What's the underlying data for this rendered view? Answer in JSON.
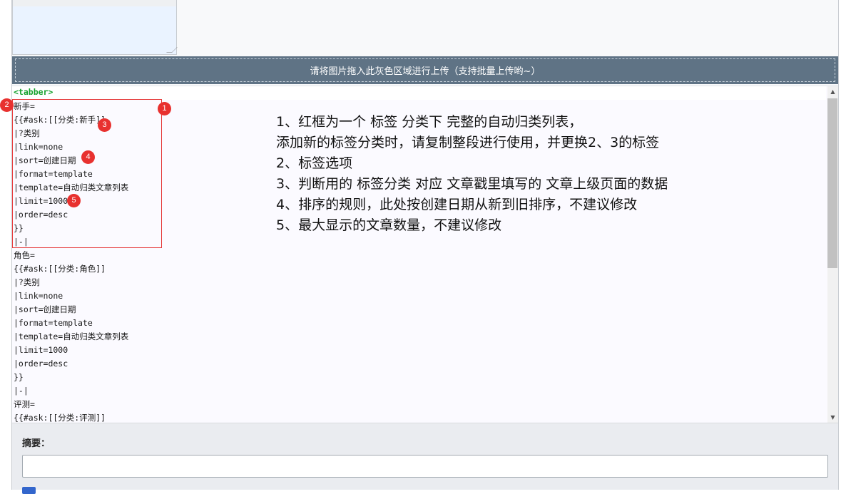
{
  "upload_hint": "请将图片拖入此灰色区域进行上传（支持批量上传哟~）",
  "editor": {
    "tag": "<tabber>",
    "lines": [
      "新手=",
      "{{#ask:[[分类:新手]]",
      "|?类别",
      "|link=none",
      "|sort=创建日期",
      "|format=template",
      "|template=自动归类文章列表",
      "|limit=1000",
      "|order=desc",
      "}}",
      "|-|",
      "角色=",
      "{{#ask:[[分类:角色]]",
      "|?类别",
      "|link=none",
      "|sort=创建日期",
      "|format=template",
      "|template=自动归类文章列表",
      "|limit=1000",
      "|order=desc",
      "}}",
      "|-|",
      "评测=",
      "{{#ask:[[分类:评测]]"
    ]
  },
  "badges": [
    "1",
    "2",
    "3",
    "4",
    "5"
  ],
  "notes": [
    "1、红框为一个 标签 分类下 完整的自动归类列表，",
    "添加新的标签分类时，请复制整段进行使用，并更换2、3的标签",
    "2、标签选项",
    "3、判断用的 标签分类 对应 文章戳里填写的 文章上级页面的数据",
    "4、排序的规则，此处按创建日期从新到旧排序，不建议修改",
    "5、最大显示的文章数量，不建议修改"
  ],
  "summary": {
    "label": "摘要：",
    "value": ""
  },
  "colors": {
    "upload_bar": "#5f7385",
    "annotation_red": "#e8312f",
    "tag_green": "#15a22d"
  }
}
